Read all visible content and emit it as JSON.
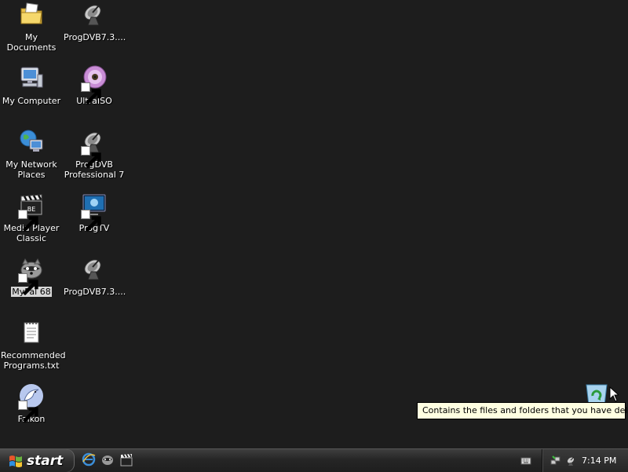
{
  "desktop": {
    "icons": [
      {
        "label": "My Documents",
        "icon": "my-documents-folder-icon"
      },
      {
        "label": "ProgDVB7.3....",
        "icon": "satellite-dish-icon"
      },
      {
        "label": "My Computer",
        "icon": "my-computer-icon"
      },
      {
        "label": "UltraISO",
        "icon": "ultraiso-disc-icon"
      },
      {
        "label": "My Network Places",
        "icon": "network-places-icon"
      },
      {
        "label": "ProgDVB Professional 7",
        "icon": "satellite-dish-icon"
      },
      {
        "label": "Media Player Classic",
        "icon": "clapperboard-icon"
      },
      {
        "label": "ProgTV",
        "icon": "progtv-monitor-icon"
      },
      {
        "label": "MyPal 68",
        "icon": "raccoon-icon"
      },
      {
        "label": "ProgDVB7.3....",
        "icon": "satellite-dish-icon"
      },
      {
        "label": "Recommended Programs.txt",
        "icon": "notepad-document-icon"
      },
      {
        "label": "Falkon",
        "icon": "falkon-bird-icon"
      }
    ],
    "recycle_bin": {
      "icon": "recycle-bin-icon"
    },
    "tooltip": "Contains the files and folders that you have deleted."
  },
  "taskbar": {
    "start_label": "start",
    "quick_launch": [
      "internet-explorer-icon",
      "raccoon-icon",
      "clapperboard-icon"
    ],
    "tray_icons": [
      "network-icon",
      "satellite-dish-icon"
    ],
    "clock": "7:14 PM"
  }
}
